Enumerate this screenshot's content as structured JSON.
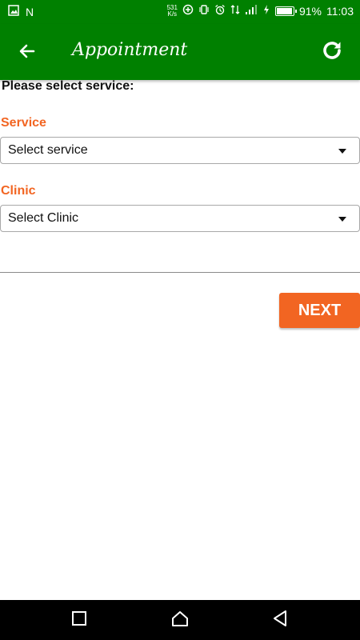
{
  "status_bar": {
    "net_speed_value": "531",
    "net_speed_unit": "K/s",
    "battery_text": "91%",
    "battery_level": 0.91,
    "time": "11:03",
    "notification_letter": "N"
  },
  "app_bar": {
    "title": "Appointment"
  },
  "form": {
    "prompt": "Please select service:",
    "service_label": "Service",
    "service_value": "Select service",
    "clinic_label": "Clinic",
    "clinic_value": "Select Clinic",
    "next_label": "NEXT"
  },
  "colors": {
    "primary": "#008000",
    "accent": "#f26522"
  }
}
